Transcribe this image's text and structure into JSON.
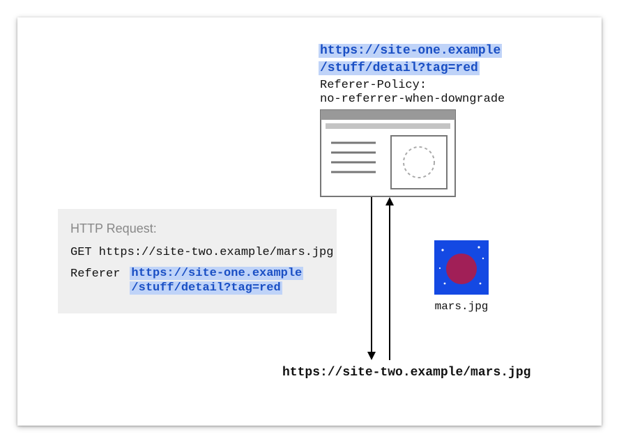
{
  "source_url_line1": "https://site-one.example",
  "source_url_line2": "/stuff/detail?tag=red",
  "policy_label": "Referer-Policy:\nno-referrer-when-downgrade",
  "http_box": {
    "title": "HTTP Request:",
    "get_line": "GET https://site-two.example/mars.jpg",
    "referer_label": "Referer",
    "referer_url_line1": "https://site-one.example",
    "referer_url_line2": "/stuff/detail?tag=red"
  },
  "image_label": "mars.jpg",
  "destination_url": "https://site-two.example/mars.jpg",
  "colors": {
    "highlight_bg": "#bfd3f8",
    "highlight_fg": "#1a4fc4",
    "box_bg": "#efefef",
    "mars_bg": "#1449e3",
    "mars_planet": "#a11f57"
  }
}
